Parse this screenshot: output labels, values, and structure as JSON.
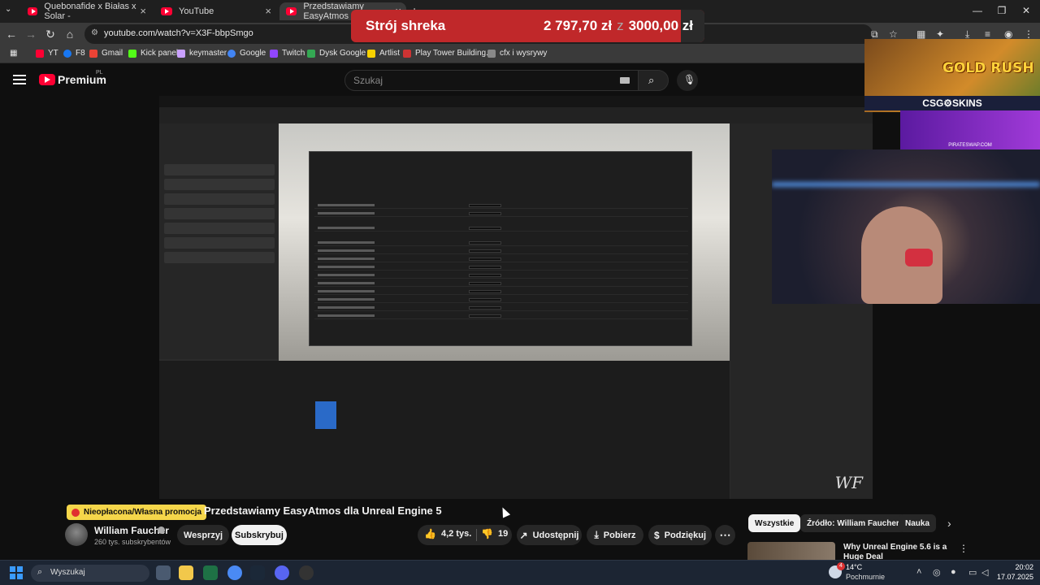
{
  "browser": {
    "tabs": [
      {
        "label": "Quebonafide x Białas x Solar - "
      },
      {
        "label": "YouTube"
      },
      {
        "label": "Przedstawiamy EasyAtmos"
      }
    ],
    "url": "youtube.com/watch?v=X3F-bbpSmgo",
    "bookmarks": [
      {
        "label": "YT"
      },
      {
        "label": "F8"
      },
      {
        "label": "Gmail"
      },
      {
        "label": "Kick panel"
      },
      {
        "label": "keymaster"
      },
      {
        "label": "Google"
      },
      {
        "label": "Twitch"
      },
      {
        "label": "Dysk Google"
      },
      {
        "label": "Artlist"
      },
      {
        "label": "Play Tower Building..."
      },
      {
        "label": "cfx i wysrywy"
      }
    ]
  },
  "donation_goal": {
    "title": "Strój shreka",
    "current": "2 797,70 zł",
    "separator": "z",
    "target": "3000,00 zł",
    "progress": 0.9326,
    "color": "#c0282a"
  },
  "youtube": {
    "brand": "Premium",
    "country": "PL",
    "search_placeholder": "Szukaj",
    "video": {
      "badge": "Nieopłacona/Własna promocja",
      "title": "Przedstawiamy EasyAtmos dla Unreal Engine 5",
      "watermark": "WF"
    },
    "channel": {
      "name": "William Faucher",
      "subscribers": "260 tys. subskrybentów",
      "join_label": "Wesprzyj",
      "subscribe_label": "Subskrybuj"
    },
    "actions": {
      "likes": "4,2 tys.",
      "dislikes": "19",
      "share": "Udostępnij",
      "download": "Pobierz",
      "thanks": "Podziękuj",
      "more": "⋯"
    },
    "chips": [
      {
        "label": "Wszystkie"
      },
      {
        "label": "Źródło: William Faucher"
      },
      {
        "label": "Nauka"
      }
    ],
    "recommendation": {
      "title": "Why Unreal Engine 5.6 is a Huge Deal"
    }
  },
  "overlays": {
    "game_banner": "GOLD RUSH",
    "sponsor": "CSG⚙SKINS",
    "promo_url": "PIRATESWAP.COM"
  },
  "taskbar": {
    "search_placeholder": "Wyszukaj",
    "weather_temp": "14°C",
    "weather_desc": "Pochmurnie",
    "time": "20:02",
    "date": "17.07.2025",
    "notification_count": "4"
  }
}
